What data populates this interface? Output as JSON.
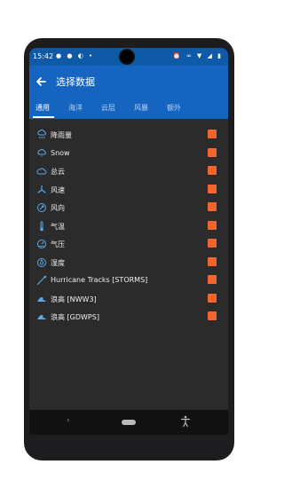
{
  "status_bar": {
    "time": "15:42",
    "left_icons": [
      "message-icon",
      "chat-icon",
      "circle-icon",
      "info-icon"
    ],
    "right_icons": [
      "alarm-icon",
      "link-icon",
      "wifi-icon",
      "signal-icon",
      "battery-icon"
    ]
  },
  "appbar": {
    "title": "选择数据"
  },
  "tabs": [
    "通用",
    "海洋",
    "云层",
    "风暴",
    "额外"
  ],
  "active_tab": "通用",
  "items": [
    {
      "label": "降雨量",
      "icon": "rain-icon",
      "checked": true
    },
    {
      "label": "Snow",
      "icon": "snow-cloud-icon",
      "checked": true
    },
    {
      "label": "总云",
      "icon": "cloud-icon",
      "checked": true
    },
    {
      "label": "风速",
      "icon": "wind-speed-icon",
      "checked": true
    },
    {
      "label": "风向",
      "icon": "wind-direction-icon",
      "checked": true
    },
    {
      "label": "气温",
      "icon": "thermometer-icon",
      "checked": true
    },
    {
      "label": "气压",
      "icon": "pressure-icon",
      "checked": true
    },
    {
      "label": "湿度",
      "icon": "humidity-icon",
      "checked": true
    },
    {
      "label": "Hurricane Tracks [STORMS]",
      "icon": "hurricane-track-icon",
      "checked": true
    },
    {
      "label": "浪高 [NWW3]",
      "icon": "wave-icon",
      "checked": true
    },
    {
      "label": "浪高 [GDWPS]",
      "icon": "wave-icon",
      "checked": true
    }
  ],
  "colors": {
    "primary": "#1565c0",
    "status": "#0e5aa7",
    "accent": "#f26430",
    "icon": "#5aa9ec",
    "background": "#2b2b2b"
  }
}
